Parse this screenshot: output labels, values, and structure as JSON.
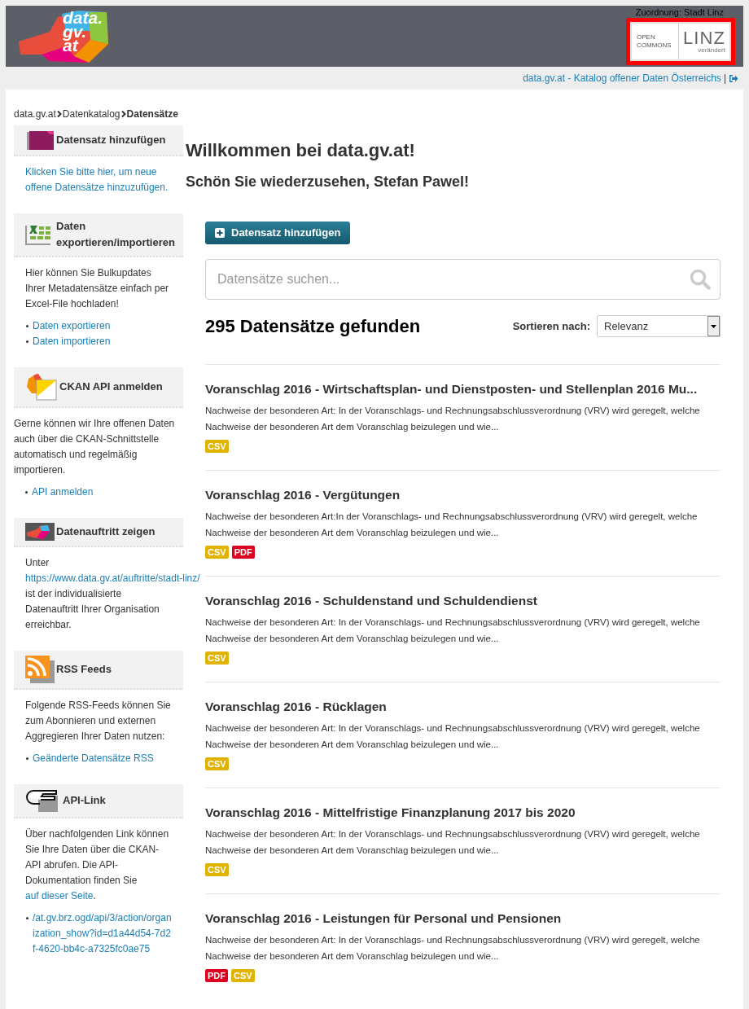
{
  "header": {
    "logo_lines": [
      "data.",
      "gv.",
      "at"
    ],
    "assignment": "Zuordnung: Stadt Linz",
    "partner": {
      "left_lines": [
        "OPEN",
        "COMMONS"
      ],
      "brand": "LINZ",
      "tagline": "verändert"
    },
    "highlighted": true
  },
  "top_link": "data.gv.at - Katalog offener Daten Österreichs",
  "top_link_separator": "|",
  "breadcrumb": [
    {
      "label": "data.gv.at",
      "current": false
    },
    {
      "label": "Datenkatalog",
      "current": false
    },
    {
      "label": "Datensätze",
      "current": true
    }
  ],
  "sidebar": [
    {
      "kind": "folder",
      "title": "Datensatz hinzufügen",
      "paragraphs": [
        [
          {
            "kind": "link",
            "text": "Klicken Sie bitte hier, um neue offene Datensätze hinzuzufügen."
          }
        ]
      ]
    },
    {
      "kind": "excel",
      "title": "Daten exportieren/importieren",
      "paragraphs": [
        [
          {
            "kind": "text",
            "text": "Hier können Sie Bulkupdates Ihrer Metadatensätze einfach per Excel-File hochladen!"
          }
        ]
      ],
      "links": [
        "Daten exportieren",
        "Daten importieren"
      ]
    },
    {
      "kind": "ckan",
      "title": "CKAN API anmelden",
      "paragraphs": [
        [
          {
            "kind": "text",
            "text": "Gerne können wir Ihre offenen Daten auch über die CKAN-Schnittstelle automatisch und regelmäßig importieren."
          }
        ]
      ],
      "links": [
        "API anmelden"
      ]
    },
    {
      "kind": "portal",
      "title": "Datenauftritt zeigen",
      "paragraphs": [
        [
          {
            "kind": "text",
            "text": "Unter "
          },
          {
            "kind": "link",
            "text": "https://www.data.gv.at"
          },
          {
            "kind": "link",
            "text": "/auftritte/stadt-linz/"
          },
          {
            "kind": "text",
            "text": " ist der individualisierte Datenauftritt Ihrer Organisation erreichbar."
          }
        ]
      ]
    },
    {
      "kind": "rss",
      "title": "RSS Feeds",
      "paragraphs": [
        [
          {
            "kind": "text",
            "text": "Folgende RSS-Feeds können Sie zum Abonnieren und externen Aggregieren Ihrer Daten nutzen:"
          }
        ]
      ],
      "links": [
        "Geänderte Datensätze RSS"
      ]
    },
    {
      "kind": "hand",
      "title": "API-Link",
      "paragraphs": [
        [
          {
            "kind": "text",
            "text": "Über nachfolgenden Link können Sie Ihre Daten über die CKAN-API abrufen. Die API-Dokumentation finden Sie "
          },
          {
            "kind": "link",
            "text": "auf dieser Seite"
          },
          {
            "kind": "text",
            "text": "."
          }
        ]
      ],
      "links": [
        "/at.gv.brz.ogd/api/3/action/organization_show?id=d1a44d54-7d2f-4620-bb4c-a7325fc0ae75"
      ]
    }
  ],
  "welcome": "Willkommen bei data.gv.at!",
  "greeting": "Schön Sie wiederzusehen, Stefan Pawel!",
  "add_button": "Datensatz hinzufügen",
  "search": {
    "placeholder": "Datensätze suchen..."
  },
  "result_count": "295 Datensätze gefunden",
  "sort": {
    "label": "Sortieren nach:",
    "value": "Relevanz"
  },
  "datasets": [
    {
      "title": "Voranschlag 2016 - Wirtschaftsplan- und Dienstposten- und Stellenplan 2016 Mu...",
      "description": "Nachweise der besonderen Art: In der Voranschlags- und Rechnungsabschlussverordnung (VRV) wird geregelt, welche Nachweise der besonderen Art dem Voranschlag beizulegen und wie...",
      "formats": [
        {
          "label": "CSV",
          "color": "#dfb300"
        }
      ]
    },
    {
      "title": "Voranschlag 2016 - Vergütungen",
      "description": "Nachweise der besonderen Art:In der Voranschlags- und Rechnungsabschlussverordnung (VRV) wird geregelt, welche Nachweise der besonderen Art dem Voranschlag beizulegen und wie...",
      "formats": [
        {
          "label": "CSV",
          "color": "#dfb300"
        },
        {
          "label": "PDF",
          "color": "#dd0020"
        }
      ]
    },
    {
      "title": "Voranschlag 2016 - Schuldenstand und Schuldendienst",
      "description": "Nachweise der besonderen Art: In der Voranschlags- und Rechnungsabschlussverordnung (VRV) wird geregelt, welche Nachweise der besonderen Art dem Voranschlag beizulegen und wie...",
      "formats": [
        {
          "label": "CSV",
          "color": "#dfb300"
        }
      ]
    },
    {
      "title": "Voranschlag 2016 - Rücklagen",
      "description": "Nachweise der besonderen Art: In der Voranschlags- und Rechnungsabschlussverordnung (VRV) wird geregelt, welche Nachweise der besonderen Art dem Voranschlag beizulegen und wie...",
      "formats": [
        {
          "label": "CSV",
          "color": "#dfb300"
        }
      ]
    },
    {
      "title": "Voranschlag 2016 - Mittelfristige Finanzplanung 2017 bis 2020",
      "description": "Nachweise der besonderen Art: In der Voranschlags- und Rechnungsabschlussverordnung (VRV) wird geregelt, welche Nachweise der besonderen Art dem Voranschlag beizulegen und wie...",
      "formats": [
        {
          "label": "CSV",
          "color": "#dfb300"
        }
      ]
    },
    {
      "title": "Voranschlag 2016 - Leistungen für Personal und Pensionen",
      "description": "Nachweise der besonderen Art: In der Voranschlags- und Rechnungsabschlussverordnung (VRV) wird geregelt, welche Nachweise der besonderen Art dem Voranschlag beizulegen und wie...",
      "formats": [
        {
          "label": "PDF",
          "color": "#dd0020"
        },
        {
          "label": "CSV",
          "color": "#dfb300"
        }
      ]
    }
  ]
}
